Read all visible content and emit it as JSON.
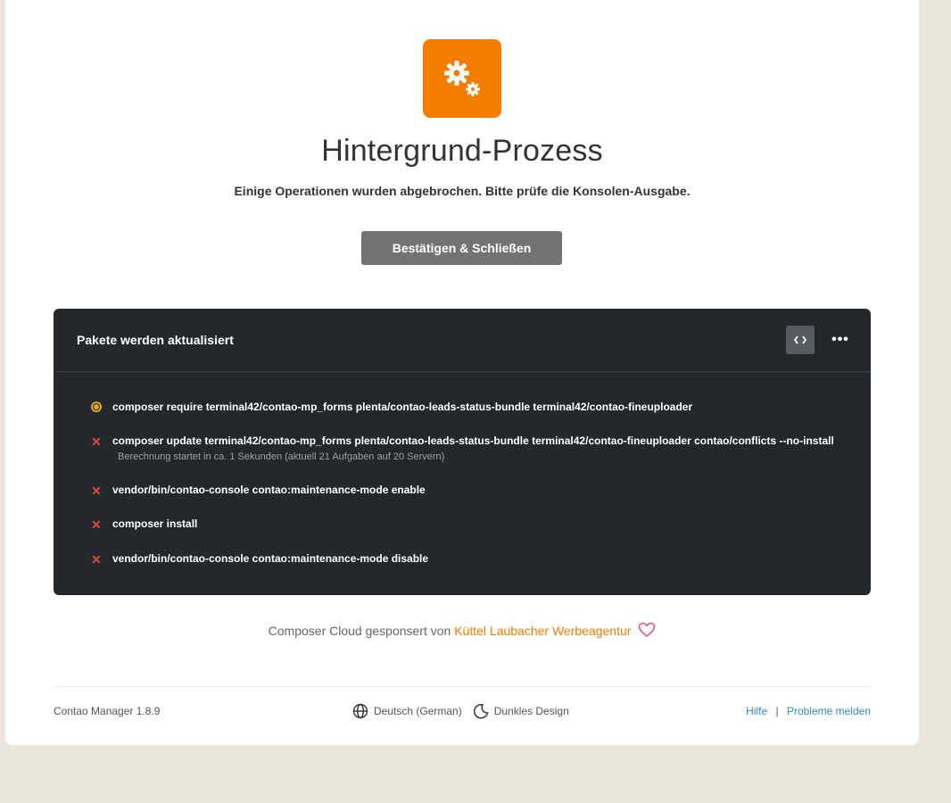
{
  "header": {
    "title": "Hintergrund-Prozess",
    "subtitle": "Einige Operationen wurden abgebrochen. Bitte prüfe die Konsolen-Ausgabe.",
    "confirm_label": "Bestätigen & Schließen",
    "icon": "gears-icon",
    "accent": "#f47c00"
  },
  "console": {
    "title": "Pakete werden aktualisiert",
    "more_label": "•••",
    "operations": [
      {
        "status": "running",
        "command": "composer require terminal42/contao-mp_forms plenta/contao-leads-status-bundle terminal42/contao-fineuploader",
        "summary": ""
      },
      {
        "status": "error",
        "command": "composer update terminal42/contao-mp_forms plenta/contao-leads-status-bundle terminal42/contao-fineuploader contao/conflicts --no-install",
        "summary": "Berechnung startet in ca. 1 Sekunden (aktuell 21 Aufgaben auf 20 Servern)"
      },
      {
        "status": "error",
        "command": "vendor/bin/contao-console contao:maintenance-mode enable",
        "summary": ""
      },
      {
        "status": "error",
        "command": "composer install",
        "summary": ""
      },
      {
        "status": "error",
        "command": "vendor/bin/contao-console contao:maintenance-mode disable",
        "summary": ""
      }
    ]
  },
  "sponsor": {
    "prefix": "Composer Cloud gesponsert von",
    "link": "Küttel Laubacher Werbeagentur"
  },
  "footer": {
    "version": "Contao Manager 1.8.9",
    "language": "Deutsch (German)",
    "theme": "Dunkles Design",
    "help": "Hilfe",
    "separator": "|",
    "report": "Probleme melden"
  }
}
